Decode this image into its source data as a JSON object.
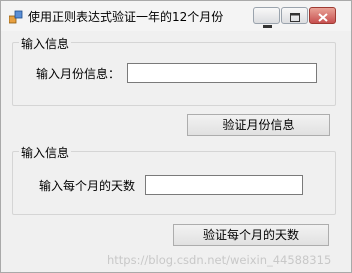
{
  "window": {
    "title": "使用正则表达式验证一年的12个月份"
  },
  "group_month": {
    "legend": "输入信息",
    "label": "输入月份信息：",
    "input_value": ""
  },
  "verify_month_button": "验证月份信息",
  "group_days": {
    "legend": "输入信息",
    "label": "输入每个月的天数",
    "input_value": ""
  },
  "verify_days_button": "验证每个月的天数",
  "watermark": "https://blog.csdn.net/weixin_44588315",
  "colors": {
    "close_button": "#c75050",
    "window_bg": "#f0f0f0"
  }
}
